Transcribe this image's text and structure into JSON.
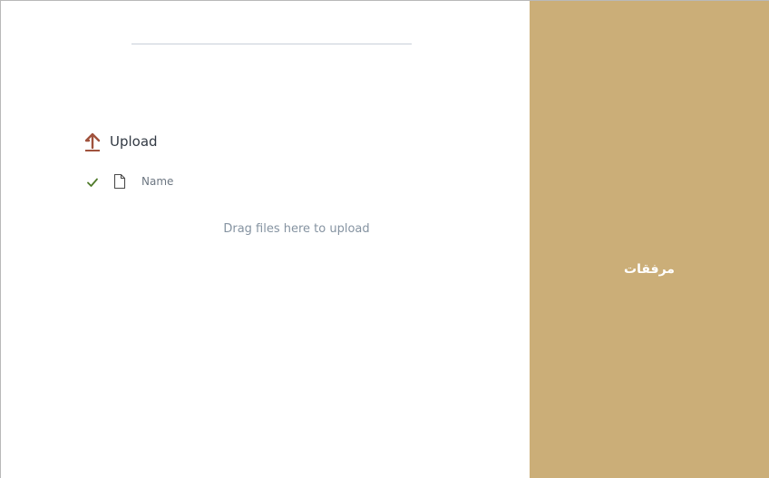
{
  "upload": {
    "label": "Upload",
    "icon": "upload-arrow-icon",
    "icon_color": "#a0523d"
  },
  "file_list": {
    "header_name": "Name",
    "check_icon": "check-icon",
    "check_color": "#4f7a2a",
    "file_icon": "document-icon"
  },
  "drop_zone": {
    "hint": "Drag files here to upload"
  },
  "side_panel": {
    "title": "مرفقات",
    "background": "#cbae78"
  }
}
